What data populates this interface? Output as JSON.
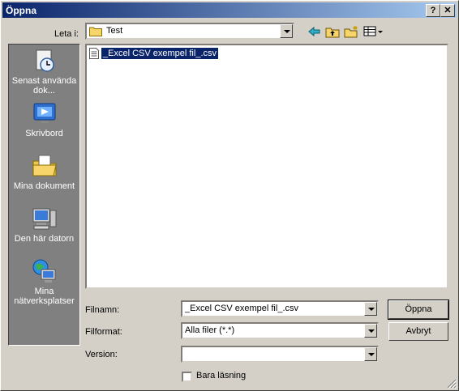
{
  "window": {
    "title": "Öppna",
    "help_btn": "?",
    "close_btn": "✕"
  },
  "toolbar": {
    "look_in_label": "Leta i:",
    "look_in_value": "Test"
  },
  "places": [
    {
      "label": "Senast använda dok..."
    },
    {
      "label": "Skrivbord"
    },
    {
      "label": "Mina dokument"
    },
    {
      "label": "Den här datorn"
    },
    {
      "label": "Mina nätverksplatser"
    }
  ],
  "files": [
    {
      "name": "_Excel CSV exempel fil_.csv",
      "selected": true
    }
  ],
  "form": {
    "filename_label": "Filnamn:",
    "filename_value": "_Excel CSV exempel fil_.csv",
    "format_label": "Filformat:",
    "format_value": "Alla filer (*.*)",
    "version_label": "Version:",
    "version_value": "",
    "readonly_label": "Bara läsning"
  },
  "buttons": {
    "open": "Öppna",
    "cancel": "Avbryt"
  },
  "colors": {
    "title_start": "#0a246a",
    "title_end": "#a6caf0",
    "selection": "#0a246a",
    "face": "#d4d0c8"
  }
}
